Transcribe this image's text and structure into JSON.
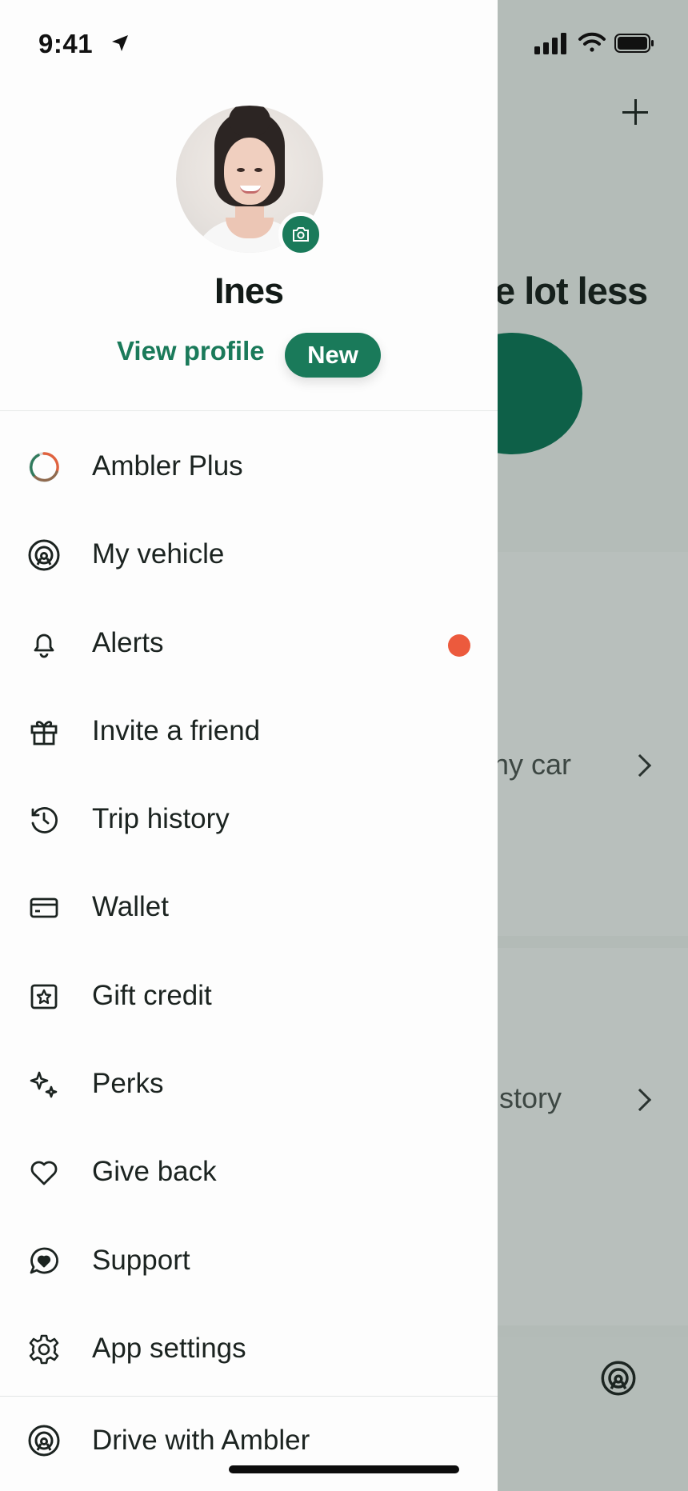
{
  "status_bar": {
    "time": "9:41"
  },
  "background_screen": {
    "headline_fragment": "e lot less",
    "row1_fragment": "ny car",
    "row2_fragment": "istory",
    "accent": "#0e6048"
  },
  "profile": {
    "name": "Ines",
    "view_profile_label": "View profile",
    "new_badge": "New"
  },
  "menu": {
    "items": [
      {
        "label": "Ambler Plus",
        "icon": "ring-progress-icon"
      },
      {
        "label": "My vehicle",
        "icon": "steering-wheel-icon"
      },
      {
        "label": "Alerts",
        "icon": "bell-icon",
        "has_notification": true
      },
      {
        "label": "Invite a friend",
        "icon": "gift-icon"
      },
      {
        "label": "Trip history",
        "icon": "history-icon"
      },
      {
        "label": "Wallet",
        "icon": "card-icon"
      },
      {
        "label": "Gift credit",
        "icon": "star-card-icon"
      },
      {
        "label": "Perks",
        "icon": "sparkles-icon"
      },
      {
        "label": "Give back",
        "icon": "heart-icon"
      },
      {
        "label": "Support",
        "icon": "chat-heart-icon"
      },
      {
        "label": "App settings",
        "icon": "gear-icon"
      }
    ],
    "footer_item": {
      "label": "Drive with Ambler",
      "icon": "steering-wheel-icon"
    }
  },
  "colors": {
    "brand_green": "#1a7a5a",
    "alert_dot": "#ec5a3d",
    "overlay": "#b3bbb7"
  }
}
